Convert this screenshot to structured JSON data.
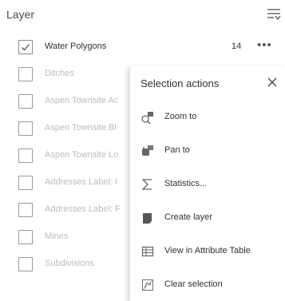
{
  "header": {
    "title": "Layer"
  },
  "layers": [
    {
      "name": "Water Polygons",
      "checked": true,
      "count": "14",
      "dim": false
    },
    {
      "name": "Ditches",
      "checked": false,
      "dim": true
    },
    {
      "name": "Aspen Townsite Ac",
      "checked": false,
      "dim": true
    },
    {
      "name": "Aspen Townsite Bl",
      "checked": false,
      "dim": true
    },
    {
      "name": "Aspen Townsite Lo",
      "checked": false,
      "dim": true
    },
    {
      "name": "Addresses Label: I",
      "checked": false,
      "dim": true
    },
    {
      "name": "Addresses Label: F",
      "checked": false,
      "dim": true
    },
    {
      "name": "Mines",
      "checked": false,
      "dim": true
    },
    {
      "name": "Subdivisions",
      "checked": false,
      "dim": true
    }
  ],
  "menu": {
    "title": "Selection actions",
    "items": [
      {
        "label": "Zoom to",
        "icon": "zoom-to-icon"
      },
      {
        "label": "Pan to",
        "icon": "pan-to-icon"
      },
      {
        "label": "Statistics...",
        "icon": "sigma-icon"
      },
      {
        "label": "Create layer",
        "icon": "create-layer-icon"
      },
      {
        "label": "View in Attribute Table",
        "icon": "table-icon"
      },
      {
        "label": "Clear selection",
        "icon": "clear-selection-icon"
      }
    ]
  },
  "colors": {
    "dim_text": "#bcbcbc",
    "text": "#323232",
    "checkbox_border": "#9a9a9a"
  }
}
